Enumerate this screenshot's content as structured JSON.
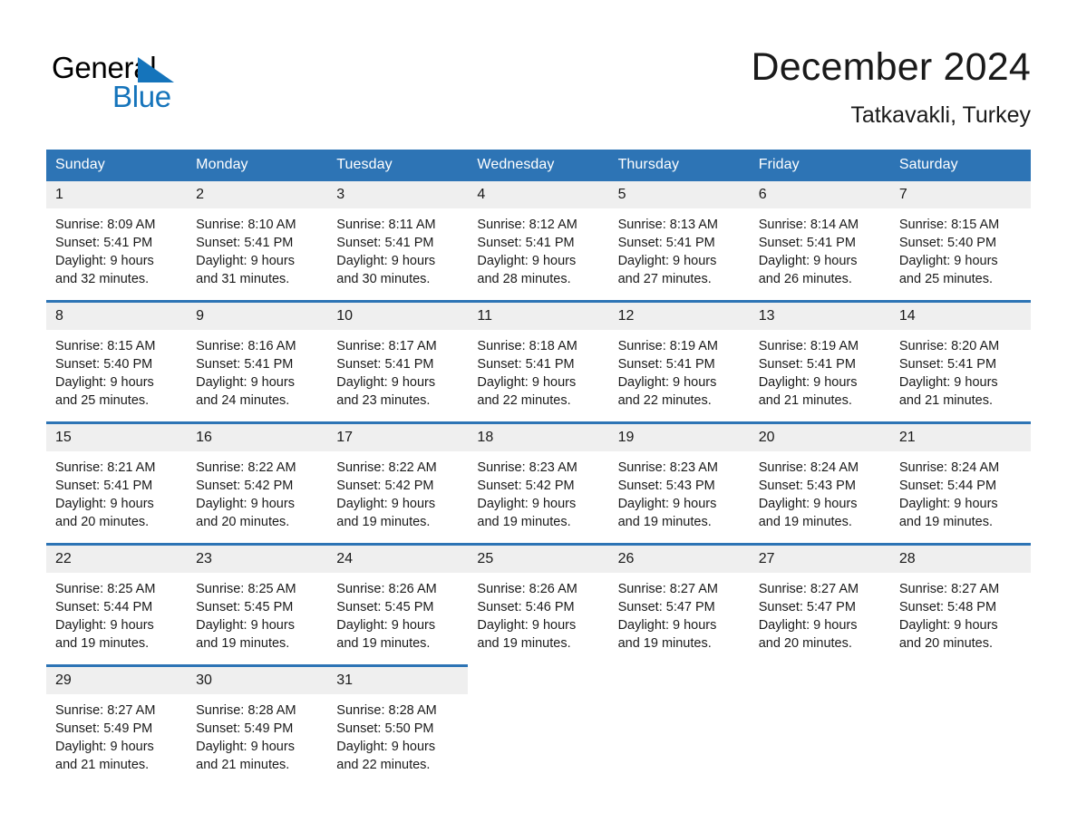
{
  "brand": {
    "name_dark": "General",
    "name_blue": "Blue",
    "triangle_icon": "brand-triangle-icon",
    "accent_color": "#1574bb"
  },
  "header": {
    "month_title": "December 2024",
    "location": "Tatkavakli, Turkey"
  },
  "theme": {
    "header_blue": "#2d74b5",
    "date_band_gray": "#efefef",
    "text": "#1a1a1a"
  },
  "weekday_headers": [
    "Sunday",
    "Monday",
    "Tuesday",
    "Wednesday",
    "Thursday",
    "Friday",
    "Saturday"
  ],
  "weeks": [
    {
      "days": [
        {
          "date": "1",
          "sunrise": "Sunrise: 8:09 AM",
          "sunset": "Sunset: 5:41 PM",
          "daylight_line1": "Daylight: 9 hours",
          "daylight_line2": "and 32 minutes."
        },
        {
          "date": "2",
          "sunrise": "Sunrise: 8:10 AM",
          "sunset": "Sunset: 5:41 PM",
          "daylight_line1": "Daylight: 9 hours",
          "daylight_line2": "and 31 minutes."
        },
        {
          "date": "3",
          "sunrise": "Sunrise: 8:11 AM",
          "sunset": "Sunset: 5:41 PM",
          "daylight_line1": "Daylight: 9 hours",
          "daylight_line2": "and 30 minutes."
        },
        {
          "date": "4",
          "sunrise": "Sunrise: 8:12 AM",
          "sunset": "Sunset: 5:41 PM",
          "daylight_line1": "Daylight: 9 hours",
          "daylight_line2": "and 28 minutes."
        },
        {
          "date": "5",
          "sunrise": "Sunrise: 8:13 AM",
          "sunset": "Sunset: 5:41 PM",
          "daylight_line1": "Daylight: 9 hours",
          "daylight_line2": "and 27 minutes."
        },
        {
          "date": "6",
          "sunrise": "Sunrise: 8:14 AM",
          "sunset": "Sunset: 5:41 PM",
          "daylight_line1": "Daylight: 9 hours",
          "daylight_line2": "and 26 minutes."
        },
        {
          "date": "7",
          "sunrise": "Sunrise: 8:15 AM",
          "sunset": "Sunset: 5:40 PM",
          "daylight_line1": "Daylight: 9 hours",
          "daylight_line2": "and 25 minutes."
        }
      ]
    },
    {
      "days": [
        {
          "date": "8",
          "sunrise": "Sunrise: 8:15 AM",
          "sunset": "Sunset: 5:40 PM",
          "daylight_line1": "Daylight: 9 hours",
          "daylight_line2": "and 25 minutes."
        },
        {
          "date": "9",
          "sunrise": "Sunrise: 8:16 AM",
          "sunset": "Sunset: 5:41 PM",
          "daylight_line1": "Daylight: 9 hours",
          "daylight_line2": "and 24 minutes."
        },
        {
          "date": "10",
          "sunrise": "Sunrise: 8:17 AM",
          "sunset": "Sunset: 5:41 PM",
          "daylight_line1": "Daylight: 9 hours",
          "daylight_line2": "and 23 minutes."
        },
        {
          "date": "11",
          "sunrise": "Sunrise: 8:18 AM",
          "sunset": "Sunset: 5:41 PM",
          "daylight_line1": "Daylight: 9 hours",
          "daylight_line2": "and 22 minutes."
        },
        {
          "date": "12",
          "sunrise": "Sunrise: 8:19 AM",
          "sunset": "Sunset: 5:41 PM",
          "daylight_line1": "Daylight: 9 hours",
          "daylight_line2": "and 22 minutes."
        },
        {
          "date": "13",
          "sunrise": "Sunrise: 8:19 AM",
          "sunset": "Sunset: 5:41 PM",
          "daylight_line1": "Daylight: 9 hours",
          "daylight_line2": "and 21 minutes."
        },
        {
          "date": "14",
          "sunrise": "Sunrise: 8:20 AM",
          "sunset": "Sunset: 5:41 PM",
          "daylight_line1": "Daylight: 9 hours",
          "daylight_line2": "and 21 minutes."
        }
      ]
    },
    {
      "days": [
        {
          "date": "15",
          "sunrise": "Sunrise: 8:21 AM",
          "sunset": "Sunset: 5:41 PM",
          "daylight_line1": "Daylight: 9 hours",
          "daylight_line2": "and 20 minutes."
        },
        {
          "date": "16",
          "sunrise": "Sunrise: 8:22 AM",
          "sunset": "Sunset: 5:42 PM",
          "daylight_line1": "Daylight: 9 hours",
          "daylight_line2": "and 20 minutes."
        },
        {
          "date": "17",
          "sunrise": "Sunrise: 8:22 AM",
          "sunset": "Sunset: 5:42 PM",
          "daylight_line1": "Daylight: 9 hours",
          "daylight_line2": "and 19 minutes."
        },
        {
          "date": "18",
          "sunrise": "Sunrise: 8:23 AM",
          "sunset": "Sunset: 5:42 PM",
          "daylight_line1": "Daylight: 9 hours",
          "daylight_line2": "and 19 minutes."
        },
        {
          "date": "19",
          "sunrise": "Sunrise: 8:23 AM",
          "sunset": "Sunset: 5:43 PM",
          "daylight_line1": "Daylight: 9 hours",
          "daylight_line2": "and 19 minutes."
        },
        {
          "date": "20",
          "sunrise": "Sunrise: 8:24 AM",
          "sunset": "Sunset: 5:43 PM",
          "daylight_line1": "Daylight: 9 hours",
          "daylight_line2": "and 19 minutes."
        },
        {
          "date": "21",
          "sunrise": "Sunrise: 8:24 AM",
          "sunset": "Sunset: 5:44 PM",
          "daylight_line1": "Daylight: 9 hours",
          "daylight_line2": "and 19 minutes."
        }
      ]
    },
    {
      "days": [
        {
          "date": "22",
          "sunrise": "Sunrise: 8:25 AM",
          "sunset": "Sunset: 5:44 PM",
          "daylight_line1": "Daylight: 9 hours",
          "daylight_line2": "and 19 minutes."
        },
        {
          "date": "23",
          "sunrise": "Sunrise: 8:25 AM",
          "sunset": "Sunset: 5:45 PM",
          "daylight_line1": "Daylight: 9 hours",
          "daylight_line2": "and 19 minutes."
        },
        {
          "date": "24",
          "sunrise": "Sunrise: 8:26 AM",
          "sunset": "Sunset: 5:45 PM",
          "daylight_line1": "Daylight: 9 hours",
          "daylight_line2": "and 19 minutes."
        },
        {
          "date": "25",
          "sunrise": "Sunrise: 8:26 AM",
          "sunset": "Sunset: 5:46 PM",
          "daylight_line1": "Daylight: 9 hours",
          "daylight_line2": "and 19 minutes."
        },
        {
          "date": "26",
          "sunrise": "Sunrise: 8:27 AM",
          "sunset": "Sunset: 5:47 PM",
          "daylight_line1": "Daylight: 9 hours",
          "daylight_line2": "and 19 minutes."
        },
        {
          "date": "27",
          "sunrise": "Sunrise: 8:27 AM",
          "sunset": "Sunset: 5:47 PM",
          "daylight_line1": "Daylight: 9 hours",
          "daylight_line2": "and 20 minutes."
        },
        {
          "date": "28",
          "sunrise": "Sunrise: 8:27 AM",
          "sunset": "Sunset: 5:48 PM",
          "daylight_line1": "Daylight: 9 hours",
          "daylight_line2": "and 20 minutes."
        }
      ]
    },
    {
      "days": [
        {
          "date": "29",
          "sunrise": "Sunrise: 8:27 AM",
          "sunset": "Sunset: 5:49 PM",
          "daylight_line1": "Daylight: 9 hours",
          "daylight_line2": "and 21 minutes."
        },
        {
          "date": "30",
          "sunrise": "Sunrise: 8:28 AM",
          "sunset": "Sunset: 5:49 PM",
          "daylight_line1": "Daylight: 9 hours",
          "daylight_line2": "and 21 minutes."
        },
        {
          "date": "31",
          "sunrise": "Sunrise: 8:28 AM",
          "sunset": "Sunset: 5:50 PM",
          "daylight_line1": "Daylight: 9 hours",
          "daylight_line2": "and 22 minutes."
        }
      ]
    }
  ]
}
